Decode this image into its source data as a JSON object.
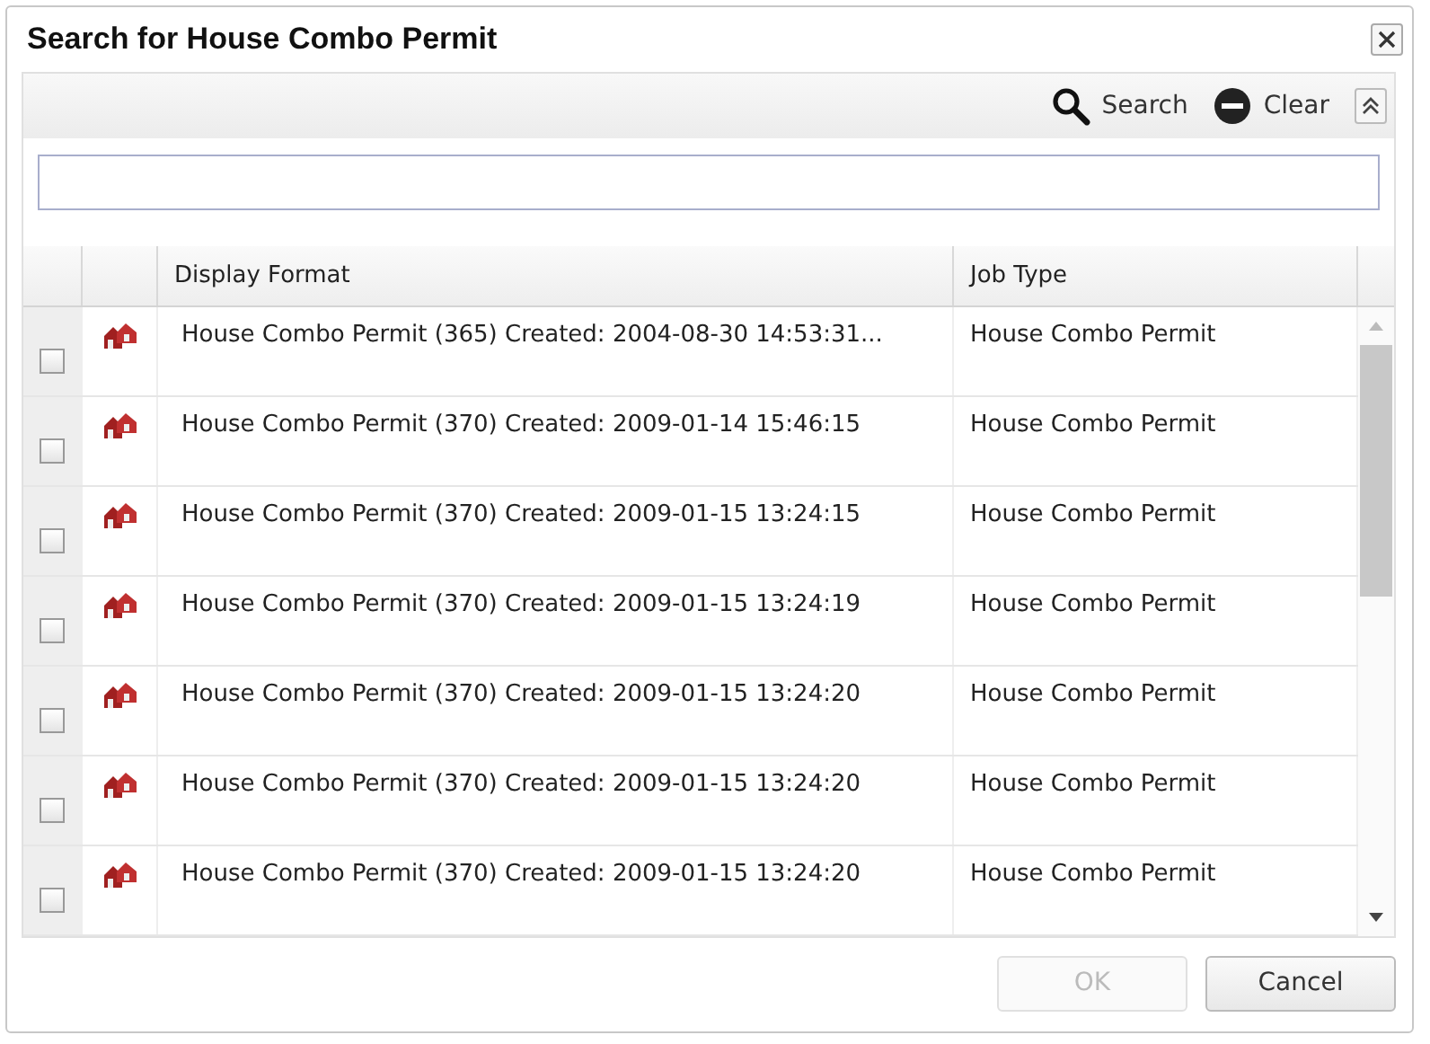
{
  "window": {
    "title": "Search for House Combo Permit"
  },
  "toolbar": {
    "search": "Search",
    "clear": "Clear"
  },
  "table": {
    "columns": [
      "Display Format",
      "Job Type"
    ],
    "rows": [
      {
        "checked": false,
        "display": "House Combo Permit (365) Created: 2004-08-30 14:53:31...",
        "job_type": "House Combo Permit"
      },
      {
        "checked": false,
        "display": "House Combo Permit (370) Created: 2009-01-14 15:46:15",
        "job_type": "House Combo Permit"
      },
      {
        "checked": false,
        "display": "House Combo Permit (370) Created: 2009-01-15 13:24:15",
        "job_type": "House Combo Permit"
      },
      {
        "checked": false,
        "display": "House Combo Permit (370) Created: 2009-01-15 13:24:19",
        "job_type": "House Combo Permit"
      },
      {
        "checked": false,
        "display": "House Combo Permit (370) Created: 2009-01-15 13:24:20",
        "job_type": "House Combo Permit"
      },
      {
        "checked": false,
        "display": "House Combo Permit (370) Created: 2009-01-15 13:24:20",
        "job_type": "House Combo Permit"
      },
      {
        "checked": false,
        "display": "House Combo Permit (370) Created: 2009-01-15 13:24:20",
        "job_type": "House Combo Permit"
      }
    ]
  },
  "buttons": [
    {
      "label": "OK",
      "disabled": true
    },
    {
      "label": "Cancel",
      "disabled": false
    }
  ]
}
